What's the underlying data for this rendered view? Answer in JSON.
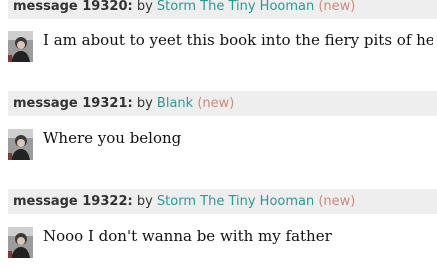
{
  "messages": [
    {
      "label": "message 19320:",
      "by": "by",
      "author": "Storm The Tiny Hooman",
      "tag": "(new)",
      "text": "I am about to yeet this book into the fiery pits of hell",
      "avatar": "user-avatar-icon"
    },
    {
      "label": "message 19321:",
      "by": "by",
      "author": "Blank",
      "tag": "(new)",
      "text": "Where you belong",
      "avatar": "user-avatar-icon"
    },
    {
      "label": "message 19322:",
      "by": "by",
      "author": "Storm The Tiny Hooman",
      "tag": "(new)",
      "text": "Nooo I don't wanna be with my father",
      "avatar": "user-avatar-icon"
    }
  ],
  "colors": {
    "header_bg": "#eeeeee",
    "author_link": "#2a9a92",
    "new_tag": "#ce8a7a"
  }
}
